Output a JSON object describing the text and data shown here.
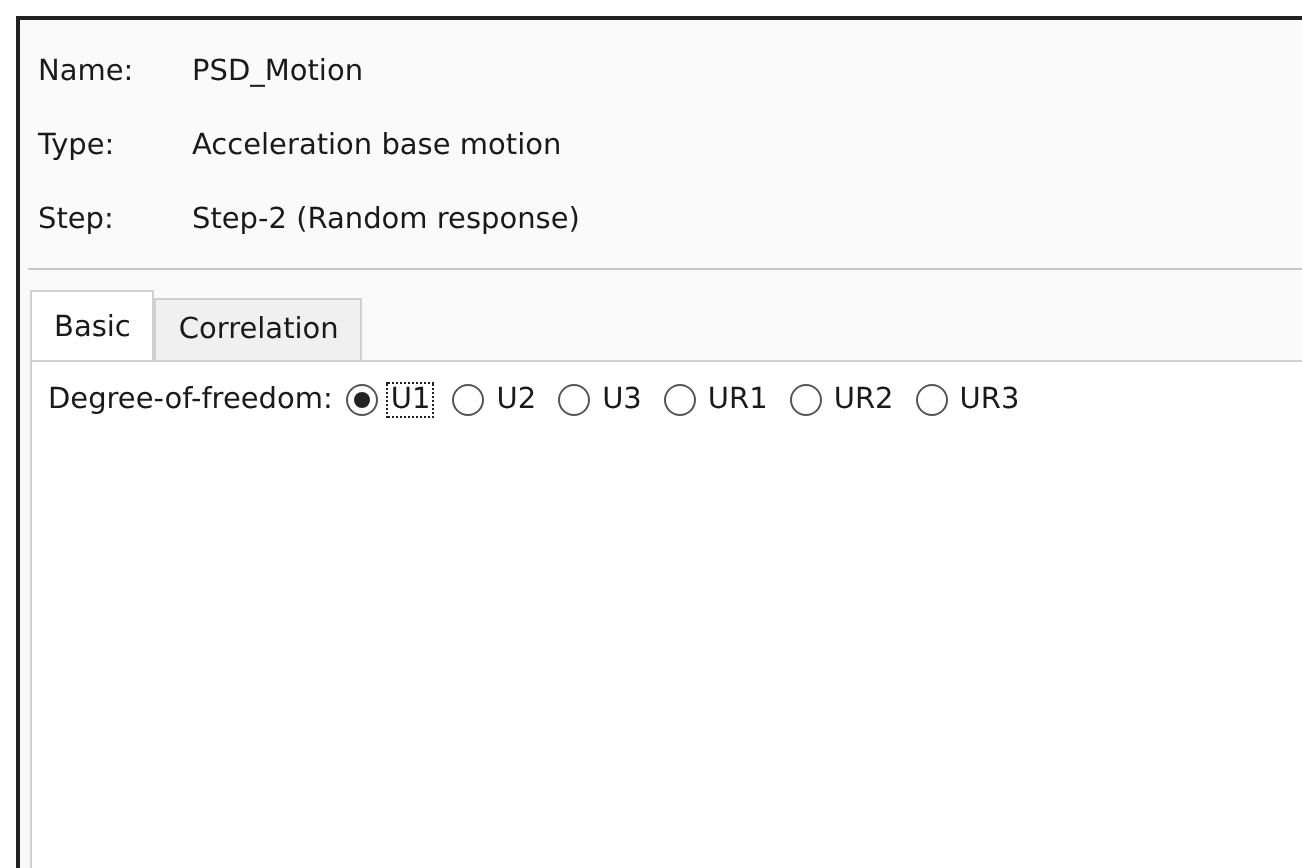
{
  "fields": [
    {
      "label": "Name:",
      "value": "PSD_Motion"
    },
    {
      "label": "Type:",
      "value": "Acceleration base motion"
    },
    {
      "label": "Step:",
      "value": "Step-2 (Random response)"
    }
  ],
  "tabs": [
    {
      "label": "Basic",
      "selected": true
    },
    {
      "label": "Correlation",
      "selected": false
    }
  ],
  "dof": {
    "label": "Degree-of-freedom:",
    "options": [
      {
        "label": "U1",
        "selected": true,
        "focused": true
      },
      {
        "label": "U2",
        "selected": false,
        "focused": false
      },
      {
        "label": "U3",
        "selected": false,
        "focused": false
      },
      {
        "label": "UR1",
        "selected": false,
        "focused": false
      },
      {
        "label": "UR2",
        "selected": false,
        "focused": false
      },
      {
        "label": "UR3",
        "selected": false,
        "focused": false
      }
    ]
  }
}
